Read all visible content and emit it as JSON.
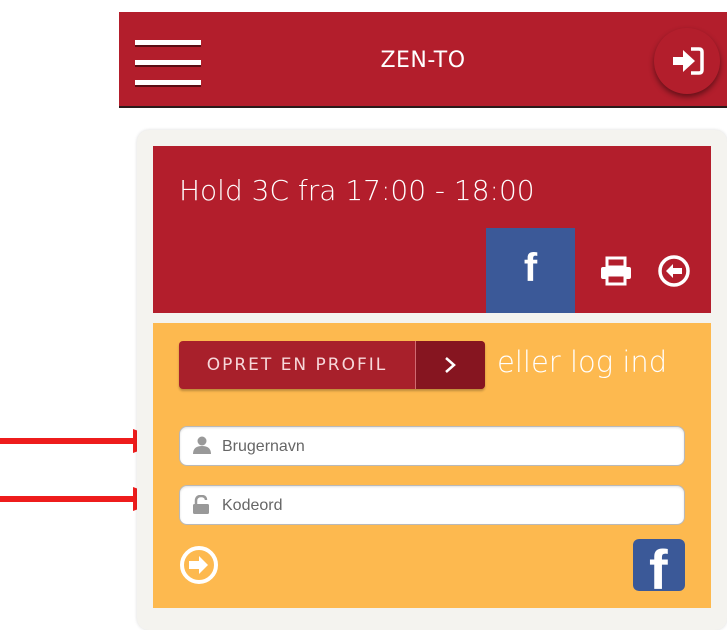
{
  "header": {
    "title": "ZEN-TO",
    "menu_icon": "hamburger-menu-icon",
    "login_icon": "sign-in-icon"
  },
  "class_info": {
    "title": "Hold 3C fra 17:00 - 18:00",
    "share_facebook_label": "f",
    "print_icon": "printer-icon",
    "back_icon": "back-arrow-icon"
  },
  "login_panel": {
    "create_profile_label": "OPRET EN PROFIL",
    "create_profile_arrow": ">",
    "or_login_text": "eller log ind",
    "username": {
      "placeholder": "Brugernavn",
      "value": ""
    },
    "password": {
      "placeholder": "Kodeord",
      "value": ""
    },
    "submit_icon": "circle-arrow-right-icon",
    "facebook_login_label": "f"
  },
  "annotations": {
    "arrow_color": "#ee1c1c",
    "arrows": [
      "username-field",
      "password-field"
    ]
  },
  "colors": {
    "brand_red": "#b31e2c",
    "panel_orange": "#fdb94f",
    "facebook_blue": "#3b5998"
  }
}
